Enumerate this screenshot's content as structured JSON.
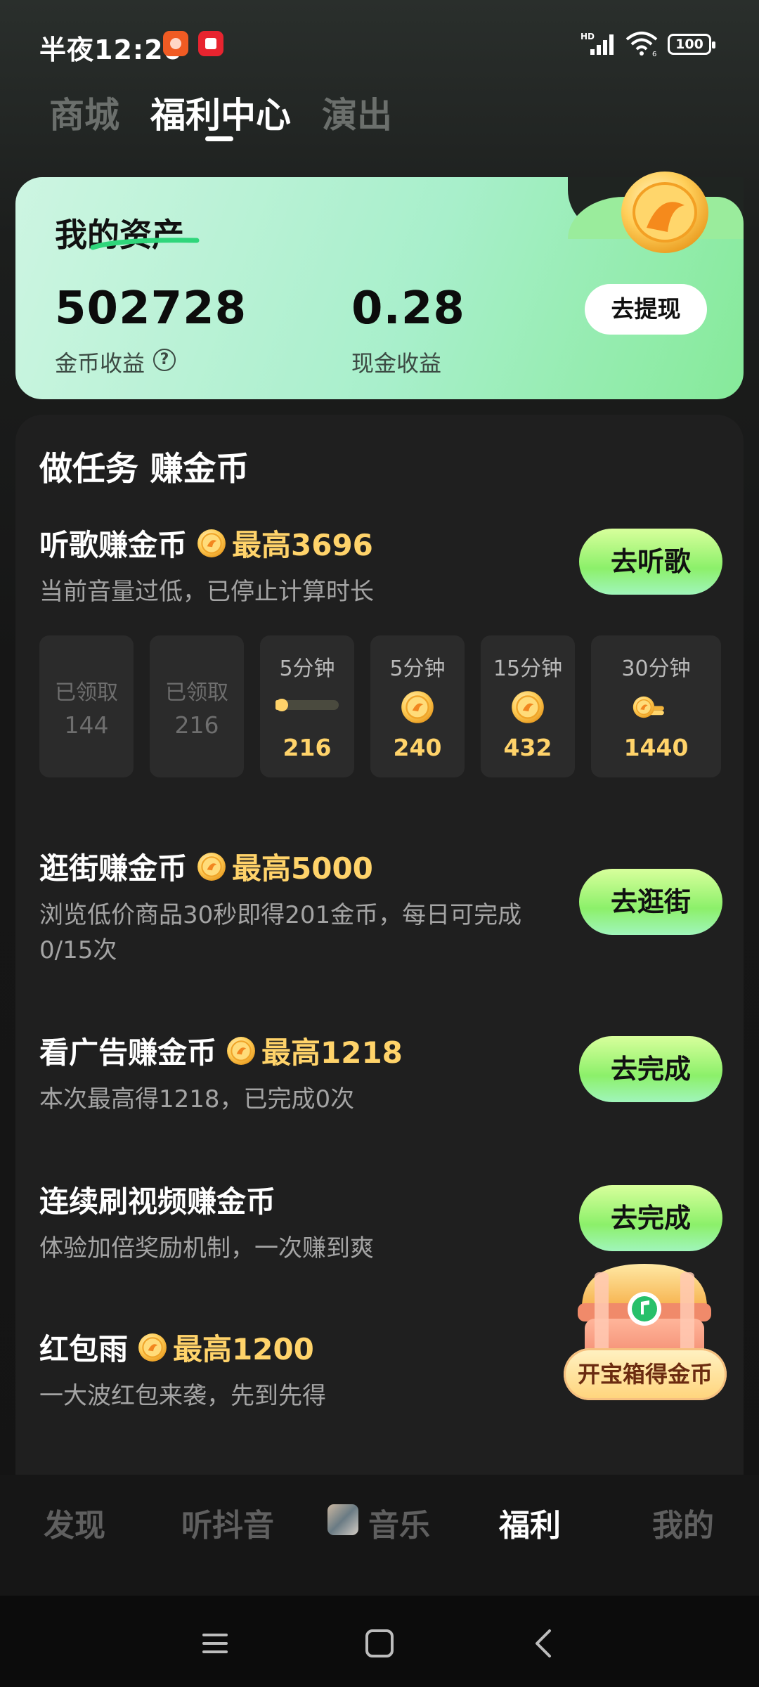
{
  "status_bar": {
    "time": "半夜12:20",
    "battery": "100",
    "icons": [
      "app-notification-icon",
      "video-app-icon",
      "hd-signal-icon",
      "wifi-icon",
      "battery-icon"
    ]
  },
  "top_tabs": [
    {
      "label": "商城",
      "active": false
    },
    {
      "label": "福利中心",
      "active": true
    },
    {
      "label": "演出",
      "active": false
    }
  ],
  "assets": {
    "title": "我的资产",
    "coins": "502728",
    "coins_label": "金币收益",
    "cash": "0.28",
    "cash_label": "现金收益",
    "withdraw_label": "去提现",
    "help_glyph": "?"
  },
  "tasks": {
    "title": "做任务 赚金币",
    "listen": {
      "title": "听歌赚金币",
      "max": "最高3696",
      "desc": "当前音量过低，已停止计算时长",
      "button": "去听歌",
      "milestones": [
        {
          "label": "已领取",
          "value": "144",
          "done": true
        },
        {
          "label": "已领取",
          "value": "216",
          "done": true
        },
        {
          "label": "5分钟",
          "value": "216",
          "done": false,
          "progress": 0.05
        },
        {
          "label": "5分钟",
          "value": "240",
          "done": false
        },
        {
          "label": "15分钟",
          "value": "432",
          "done": false
        },
        {
          "label": "30分钟",
          "value": "1440",
          "done": false
        }
      ]
    },
    "shop": {
      "title": "逛街赚金币",
      "max": "最高5000",
      "desc": "浏览低价商品30秒即得201金币，每日可完成0/15次",
      "button": "去逛街"
    },
    "ads": {
      "title": "看广告赚金币",
      "max": "最高1218",
      "desc": "本次最高得1218，已完成0次",
      "button": "去完成"
    },
    "video": {
      "title": "连续刷视频赚金币",
      "desc": "体验加倍奖励机制，一次赚到爽",
      "button": "去完成"
    },
    "redpack": {
      "title": "红包雨",
      "max": "最高1200",
      "desc": "一大波红包来袭，先到先得"
    },
    "chest_label": "开宝箱得金币"
  },
  "bottom_nav": [
    {
      "label": "发现",
      "active": false
    },
    {
      "label": "听抖音",
      "active": false
    },
    {
      "label": "音乐",
      "active": false
    },
    {
      "label": "福利",
      "active": true
    },
    {
      "label": "我的",
      "active": false
    }
  ],
  "colors": {
    "accent_gold": "#ffd36a",
    "button_green": "#8cf06a",
    "card_mint": "#a8efcb",
    "panel": "#1f1f1f"
  }
}
